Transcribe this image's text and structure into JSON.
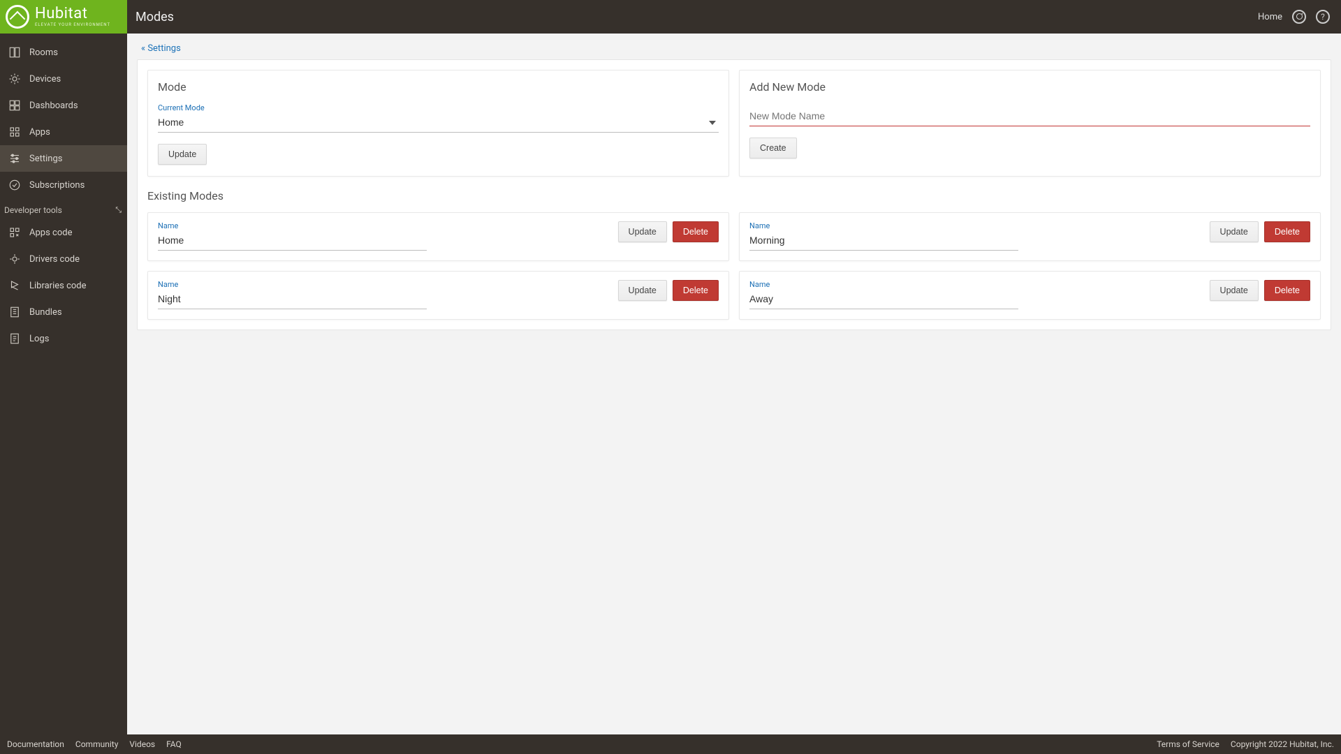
{
  "brand": {
    "name": "Hubitat",
    "tagline": "ELEVATE YOUR ENVIRONMENT"
  },
  "page": {
    "title": "Modes"
  },
  "topnav": {
    "home": "Home",
    "chat_icon": "chat-icon",
    "help_icon": "help-icon",
    "help_glyph": "?"
  },
  "sidebar": {
    "items": [
      {
        "key": "rooms",
        "label": "Rooms"
      },
      {
        "key": "devices",
        "label": "Devices"
      },
      {
        "key": "dashboards",
        "label": "Dashboards"
      },
      {
        "key": "apps",
        "label": "Apps"
      },
      {
        "key": "settings",
        "label": "Settings",
        "active": true
      },
      {
        "key": "subscriptions",
        "label": "Subscriptions"
      }
    ],
    "dev_header": "Developer tools",
    "dev_items": [
      {
        "key": "apps-code",
        "label": "Apps code"
      },
      {
        "key": "drivers-code",
        "label": "Drivers code"
      },
      {
        "key": "libraries-code",
        "label": "Libraries code"
      },
      {
        "key": "bundles",
        "label": "Bundles"
      },
      {
        "key": "logs",
        "label": "Logs"
      }
    ]
  },
  "breadcrumb": {
    "back": "« Settings"
  },
  "mode_panel": {
    "title": "Mode",
    "current_label": "Current Mode",
    "current_value": "Home",
    "options": [
      "Home",
      "Morning",
      "Night",
      "Away"
    ],
    "update": "Update"
  },
  "add_panel": {
    "title": "Add New Mode",
    "placeholder": "New Mode Name",
    "create": "Create"
  },
  "existing": {
    "title": "Existing Modes",
    "name_label": "Name",
    "update": "Update",
    "delete": "Delete",
    "modes": [
      {
        "name": "Home"
      },
      {
        "name": "Morning"
      },
      {
        "name": "Night"
      },
      {
        "name": "Away"
      }
    ]
  },
  "footer": {
    "links": [
      "Documentation",
      "Community",
      "Videos",
      "FAQ"
    ],
    "tos": "Terms of Service",
    "copyright": "Copyright 2022 Hubitat, Inc."
  }
}
